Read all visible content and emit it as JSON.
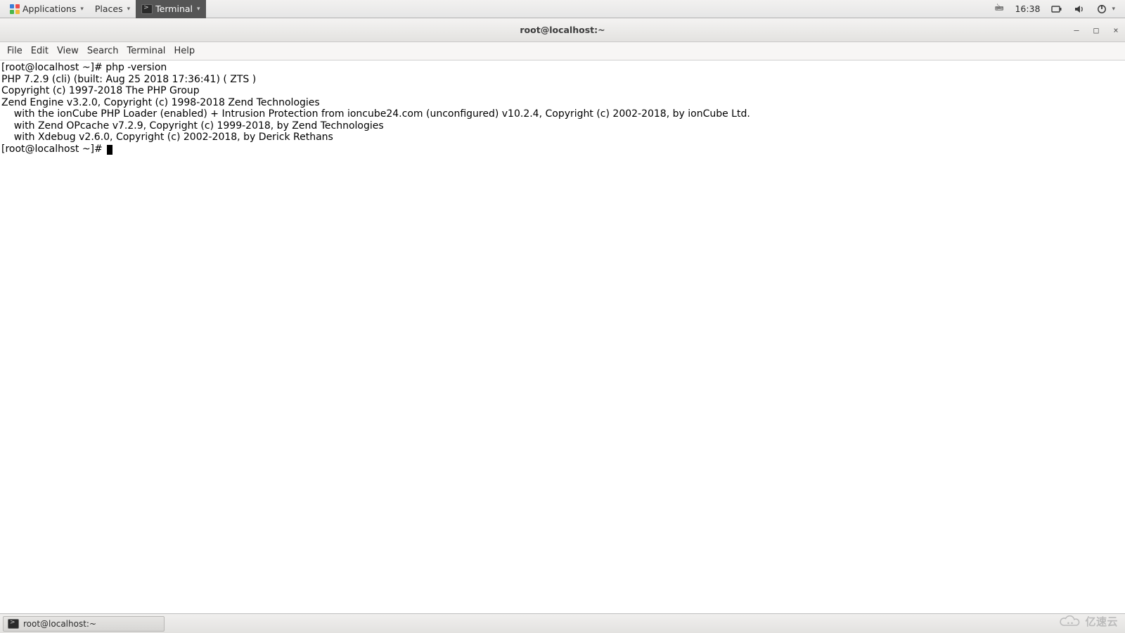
{
  "panel": {
    "applications": "Applications",
    "places": "Places",
    "terminal": "Terminal",
    "keyboard_icon": "🖮",
    "clock": "16:38"
  },
  "window": {
    "title": "root@localhost:~",
    "minimize": "—",
    "maximize": "□",
    "close": "×"
  },
  "menubar": {
    "file": "File",
    "edit": "Edit",
    "view": "View",
    "search": "Search",
    "terminal": "Terminal",
    "help": "Help"
  },
  "terminal": {
    "prompt": "[root@localhost ~]# ",
    "cmd1": "php -version",
    "out1": "PHP 7.2.9 (cli) (built: Aug 25 2018 17:36:41) ( ZTS )",
    "out2": "Copyright (c) 1997-2018 The PHP Group",
    "out3": "Zend Engine v3.2.0, Copyright (c) 1998-2018 Zend Technologies",
    "out4": "    with the ionCube PHP Loader (enabled) + Intrusion Protection from ioncube24.com (unconfigured) v10.2.4, Copyright (c) 2002-2018, by ionCube Ltd.",
    "out5": "    with Zend OPcache v7.2.9, Copyright (c) 1999-2018, by Zend Technologies",
    "out6": "    with Xdebug v2.6.0, Copyright (c) 2002-2018, by Derick Rethans"
  },
  "taskbar": {
    "item1": "root@localhost:~"
  },
  "watermark": {
    "text": "亿速云"
  }
}
